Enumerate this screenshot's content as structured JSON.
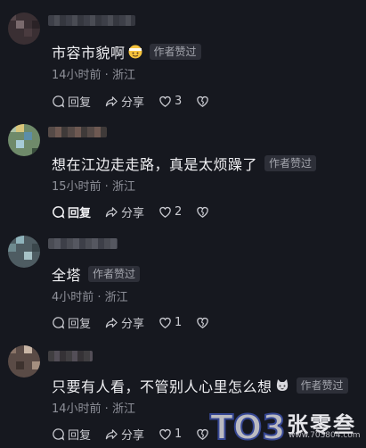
{
  "comments": [
    {
      "text": "市容市貌啊",
      "badge": "作者赞过",
      "meta": "14小时前 · 浙江",
      "reply_label": "回复",
      "share_label": "分享",
      "like_count": "3",
      "emoji": "face-with-head-bandage-emoji"
    },
    {
      "text": "想在江边走走路，真是太烦躁了",
      "badge": "作者赞过",
      "meta": "15小时前 · 浙江",
      "reply_label": "回复",
      "share_label": "分享",
      "like_count": "2"
    },
    {
      "text": "全塔",
      "badge": "作者赞过",
      "meta": "4小时前 · 浙江",
      "reply_label": "回复",
      "share_label": "分享",
      "like_count": "1"
    },
    {
      "text": "只要有人看，不管别人心里怎么想",
      "badge": "作者赞过",
      "meta": "14小时前 · 浙江",
      "reply_label": "回复",
      "share_label": "分享",
      "like_count": "1",
      "emoji": "cat-face-emoji"
    }
  ],
  "watermark": {
    "logo_text": "TO3",
    "word": "张零叁",
    "url": "www.703804.com"
  },
  "colors": {
    "background": "#16181f",
    "badge_bg": "#2d2f38",
    "meta_text": "#8e9099",
    "emoji_yellow": "#f6c33c"
  }
}
